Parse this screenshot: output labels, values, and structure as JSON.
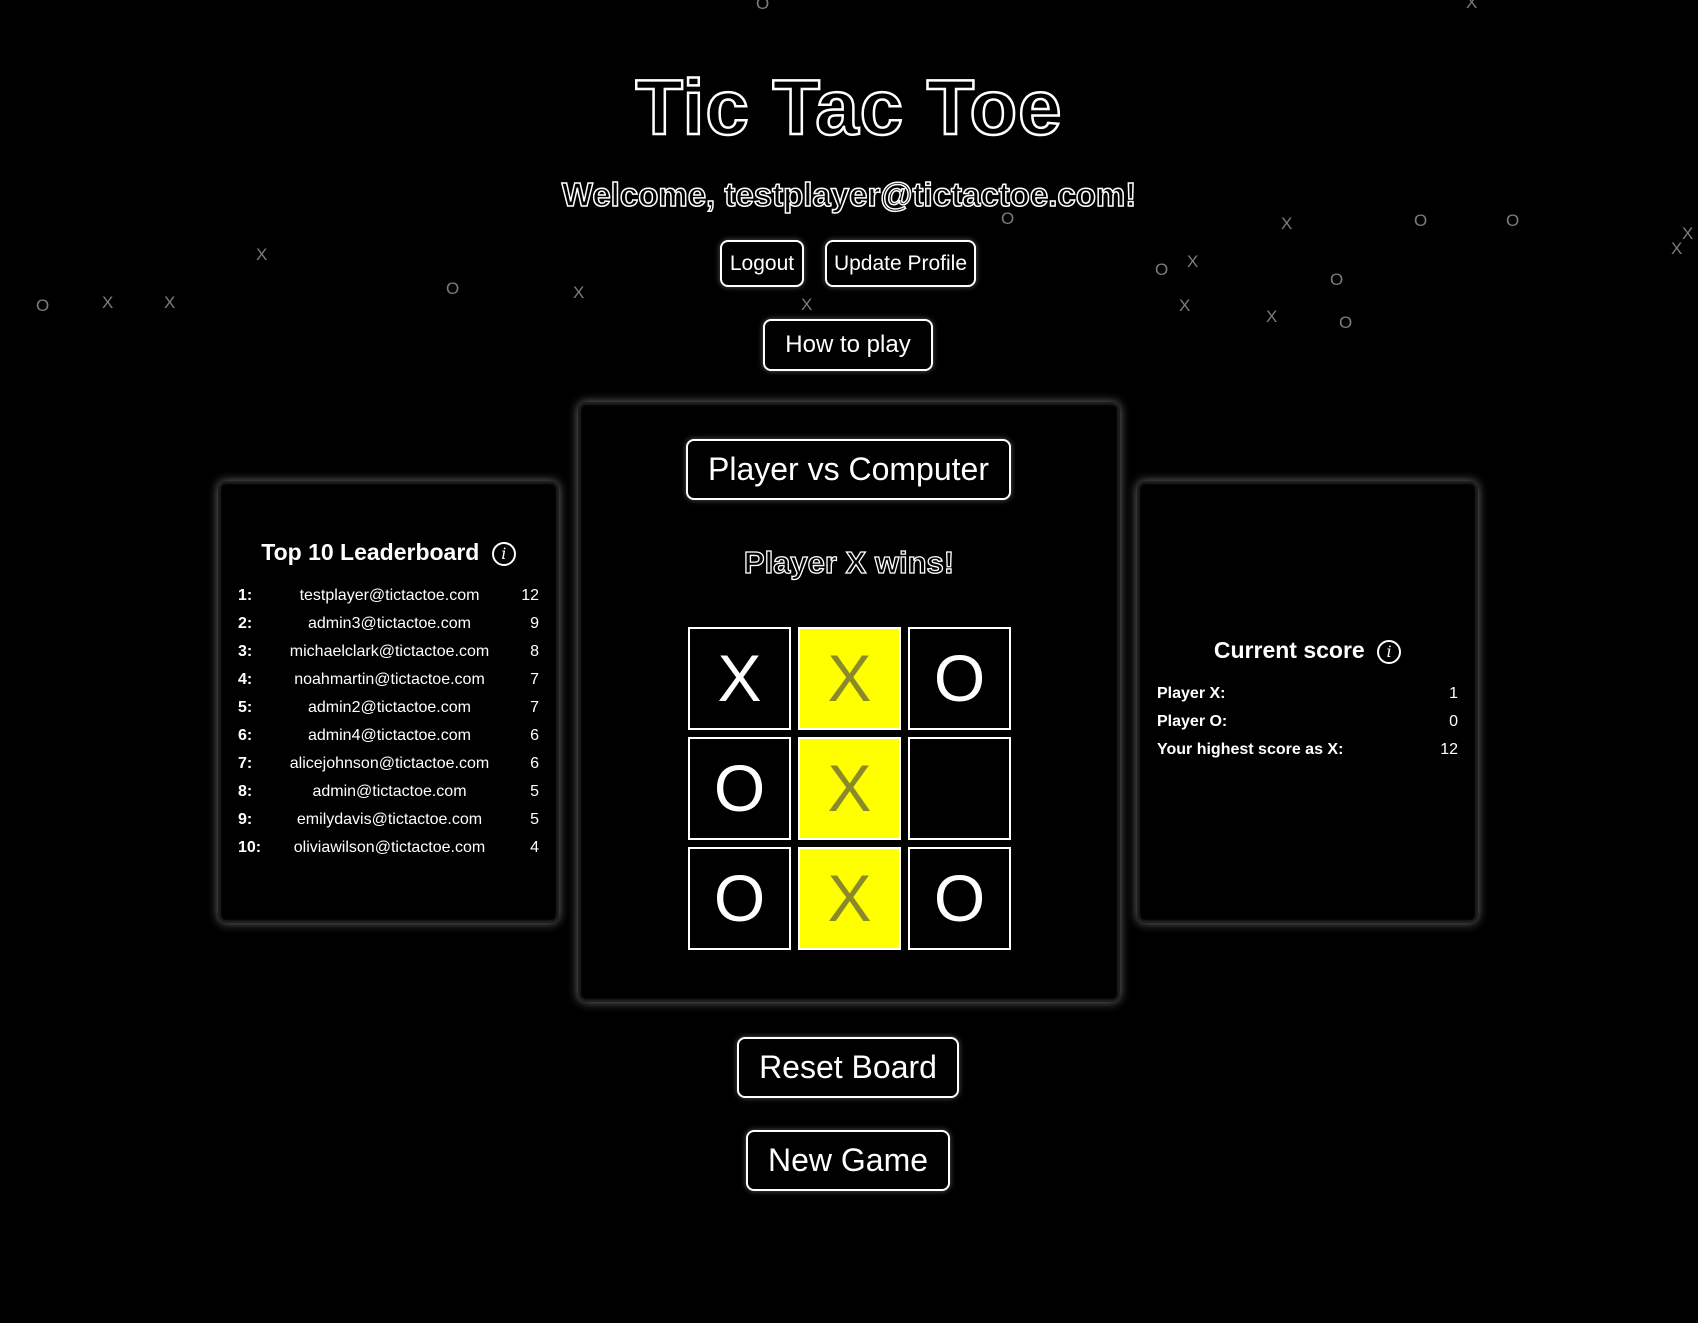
{
  "header": {
    "title": "Tic Tac Toe",
    "welcome": "Welcome, testplayer@tictactoe.com!"
  },
  "nav": {
    "logout_label": "Logout",
    "update_profile_label": "Update Profile",
    "how_to_play_label": "How to play"
  },
  "background_marks": [
    "O",
    "X",
    "X",
    "O",
    "X",
    "X",
    "O",
    "X",
    "X",
    "O",
    "O",
    "X",
    "O",
    "X",
    "X",
    "O",
    "O",
    "X",
    "X",
    "O",
    "X"
  ],
  "leaderboard": {
    "title": "Top 10 Leaderboard",
    "info_icon": "ⓘ",
    "entries": [
      {
        "rank": "1:",
        "email": "testplayer@tictactoe.com",
        "score": "12"
      },
      {
        "rank": "2:",
        "email": "admin3@tictactoe.com",
        "score": "9"
      },
      {
        "rank": "3:",
        "email": "michaelclark@tictactoe.com",
        "score": "8"
      },
      {
        "rank": "4:",
        "email": "noahmartin@tictactoe.com",
        "score": "7"
      },
      {
        "rank": "5:",
        "email": "admin2@tictactoe.com",
        "score": "7"
      },
      {
        "rank": "6:",
        "email": "admin4@tictactoe.com",
        "score": "6"
      },
      {
        "rank": "7:",
        "email": "alicejohnson@tictactoe.com",
        "score": "6"
      },
      {
        "rank": "8:",
        "email": "admin@tictactoe.com",
        "score": "5"
      },
      {
        "rank": "9:",
        "email": "emilydavis@tictactoe.com",
        "score": "5"
      },
      {
        "rank": "10:",
        "email": "oliviawilson@tictactoe.com",
        "score": "4"
      }
    ]
  },
  "game": {
    "mode_label": "Player vs Computer",
    "status": "Player X wins!",
    "cells": [
      "X",
      "X",
      "O",
      "O",
      "X",
      "",
      "O",
      "X",
      "O"
    ],
    "winning_cells": [
      1,
      4,
      7
    ],
    "win_highlight_color": "#ffff00"
  },
  "score": {
    "title": "Current score",
    "info_icon": "ⓘ",
    "rows": [
      {
        "label": "Player X:",
        "value": "1"
      },
      {
        "label": "Player O:",
        "value": "0"
      },
      {
        "label": "Your highest score as X:",
        "value": "12"
      }
    ]
  },
  "actions": {
    "reset_label": "Reset Board",
    "new_game_label": "New Game"
  }
}
